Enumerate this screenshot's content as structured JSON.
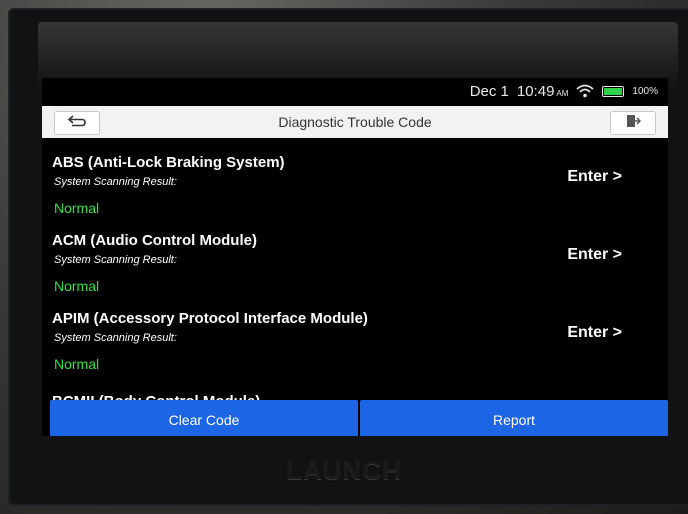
{
  "status": {
    "date": "Dec 1",
    "time": "10:49",
    "ampm": "AM",
    "battery_percent": "100%",
    "battery_level": 1.0
  },
  "header": {
    "title": "Diagnostic Trouble Code"
  },
  "systems": [
    {
      "name": "ABS (Anti-Lock Braking System)",
      "subtitle": "System Scanning Result:",
      "status": "Normal",
      "action": "Enter >"
    },
    {
      "name": "ACM (Audio Control Module)",
      "subtitle": "System Scanning Result:",
      "status": "Normal",
      "action": "Enter >"
    },
    {
      "name": "APIM (Accessory Protocol Interface Module)",
      "subtitle": "System Scanning Result:",
      "status": "Normal",
      "action": "Enter >"
    }
  ],
  "partial_item": "BCMII (Body Control Module)",
  "footer": {
    "clear_label": "Clear Code",
    "report_label": "Report"
  },
  "device": {
    "brand": "LAUNCH"
  },
  "colors": {
    "accent": "#1c66e6",
    "status_ok": "#33e040"
  },
  "icons": {
    "back": "back-arrow-icon",
    "exit": "exit-icon",
    "wifi": "wifi-icon",
    "battery": "battery-icon"
  }
}
